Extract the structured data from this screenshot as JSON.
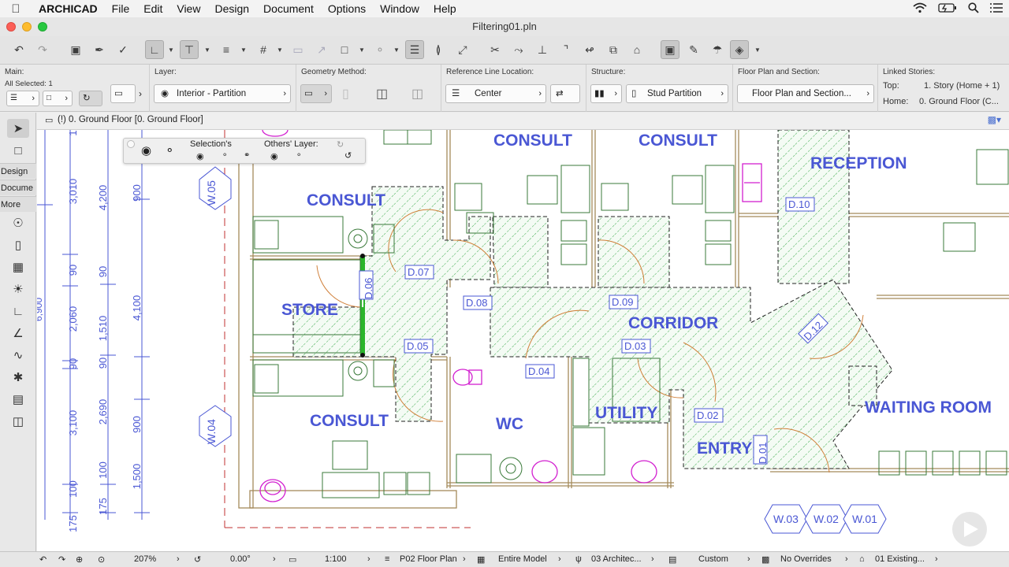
{
  "menubar": {
    "app": "ARCHICAD",
    "items": [
      "File",
      "Edit",
      "View",
      "Design",
      "Document",
      "Options",
      "Window",
      "Help"
    ]
  },
  "window": {
    "title": "Filtering01.pln"
  },
  "infobox": {
    "main_label": "Main:",
    "selected": "All Selected: 1",
    "layer_label": "Layer:",
    "layer_value": "Interior - Partition",
    "geometry_label": "Geometry Method:",
    "refline_label": "Reference Line Location:",
    "refline_value": "Center",
    "structure_label": "Structure:",
    "structure_value": "Stud Partition",
    "fpsection_label": "Floor Plan and Section:",
    "fpsection_value": "Floor Plan and Section...",
    "linked_label": "Linked Stories:",
    "top_label": "Top:",
    "top_value": "1. Story (Home + 1)",
    "home_label": "Home:",
    "home_value": "0. Ground Floor (C..."
  },
  "toolbox": {
    "groups": [
      "Design",
      "Docume",
      "More"
    ]
  },
  "view_tab": {
    "label": "(!) 0. Ground Floor [0. Ground Floor]"
  },
  "filter_palette": {
    "selection_label": "Selection's",
    "others_label": "Others' Layer:"
  },
  "plan": {
    "rooms": [
      "CONSULT",
      "CONSULT",
      "CONSULT",
      "CONSULT",
      "RECEPTION",
      "STORE",
      "CORRIDOR",
      "WAITING ROOM",
      "UTILITY",
      "WC",
      "ENTRY"
    ],
    "doors": [
      "D.10",
      "D.07",
      "D.06",
      "D.08",
      "D.09",
      "D.05",
      "D.12",
      "D.03",
      "D.04",
      "D.02",
      "D.01"
    ],
    "windows": [
      "W.05",
      "W.04",
      "W.03",
      "W.02",
      "W.01"
    ],
    "dims_outer": [
      "1",
      "3,010",
      "90",
      "2,060",
      "90",
      "3,100",
      "100",
      "175"
    ],
    "dims_total": "6,900",
    "dims_mid": [
      "4,200",
      "90",
      "1,510",
      "90",
      "2,690",
      "100",
      "175"
    ],
    "dims_inner": [
      "900",
      "4,100",
      "900",
      "1,500"
    ]
  },
  "statusbar": {
    "zoom": "207%",
    "angle": "0.00°",
    "scale": "1:100",
    "layer_combo": "P02 Floor Plan",
    "model": "Entire Model",
    "pen_set": "03 Architec...",
    "dimension": "Custom",
    "overrides": "No Overrides",
    "renovation": "01 Existing..."
  },
  "colors": {
    "annotation_blue": "#4a57d4",
    "wall_brown": "#a58a5a",
    "selection_green": "#2bb52b",
    "hatch_green": "#3aa84a",
    "fixture_magenta": "#d21fd0"
  }
}
